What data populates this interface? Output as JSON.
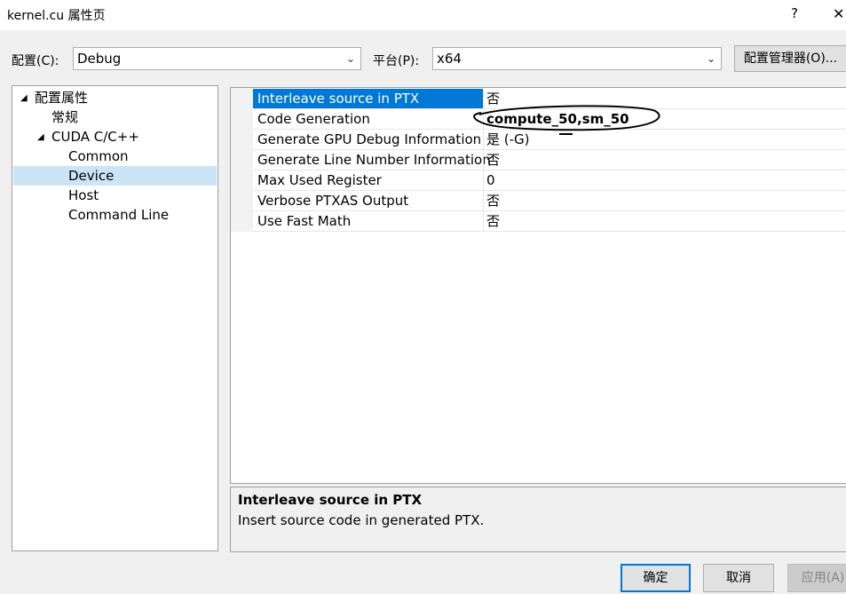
{
  "window": {
    "title": "kernel.cu 属性页",
    "help_label": "?",
    "close_label": "✕"
  },
  "config": {
    "config_label": "配置(C):",
    "config_value": "Debug",
    "platform_label": "平台(P):",
    "platform_value": "x64",
    "manager_button": "配置管理器(O)..."
  },
  "tree": {
    "items": [
      {
        "label": "配置属性",
        "expanded": true
      },
      {
        "label": "常规"
      },
      {
        "label": "CUDA C/C++",
        "expanded": true
      },
      {
        "label": "Common"
      },
      {
        "label": "Device",
        "selected": true
      },
      {
        "label": "Host"
      },
      {
        "label": "Command Line"
      }
    ]
  },
  "properties": {
    "rows": [
      {
        "name": "Interleave source in PTX",
        "value": "否",
        "selected": true
      },
      {
        "name": "Code Generation",
        "value": "compute_50,sm_50",
        "bold": true
      },
      {
        "name": "Generate GPU Debug Information",
        "value": "是 (-G)"
      },
      {
        "name": "Generate Line Number Information",
        "value": "否"
      },
      {
        "name": "Max Used Register",
        "value": "0"
      },
      {
        "name": "Verbose PTXAS Output",
        "value": "否"
      },
      {
        "name": "Use Fast Math",
        "value": "否"
      }
    ]
  },
  "description": {
    "title": "Interleave source in PTX",
    "text": "Insert source code in generated PTX."
  },
  "buttons": {
    "ok": "确定",
    "cancel": "取消",
    "apply": "应用(A)"
  },
  "colors": {
    "selection_blue": "#0078d7",
    "tree_selection": "#cce4f7"
  }
}
